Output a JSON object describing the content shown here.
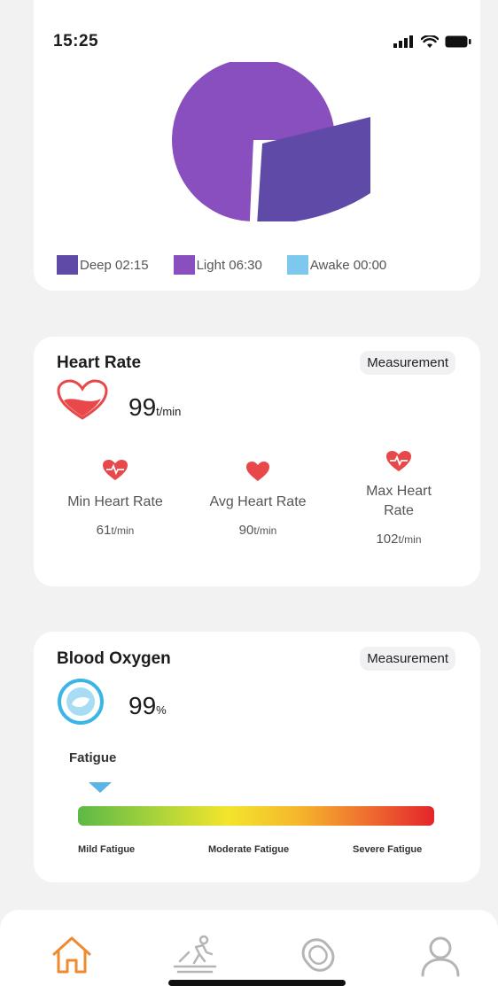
{
  "status_bar": {
    "time": "15:25"
  },
  "sleep": {
    "chart_data": {
      "type": "pie",
      "series": [
        {
          "name": "Deep",
          "value": 2.25
        },
        {
          "name": "Light",
          "value": 6.5
        },
        {
          "name": "Awake",
          "value": 0
        }
      ]
    },
    "legend": [
      {
        "label": "Deep 02:15",
        "color": "#5f4aa8"
      },
      {
        "label": "Light 06:30",
        "color": "#8a4fbf"
      },
      {
        "label": "Awake 00:00",
        "color": "#7cc8ee"
      }
    ]
  },
  "heart_rate": {
    "title": "Heart Rate",
    "measure_label": "Measurement",
    "value": "99",
    "unit": "t/min",
    "stats": [
      {
        "label": "Min Heart Rate",
        "value": "61",
        "unit": "t/min"
      },
      {
        "label": "Avg Heart Rate",
        "value": "90",
        "unit": "t/min"
      },
      {
        "label": "Max Heart Rate",
        "value": "102",
        "unit": "t/min"
      }
    ],
    "accent": "#e8484a"
  },
  "blood_oxygen": {
    "title": "Blood Oxygen",
    "measure_label": "Measurement",
    "value": "99",
    "unit": "%",
    "accent": "#3bb4e6",
    "fatigue": {
      "title": "Fatigue",
      "level": 0.03,
      "labels": [
        "Mild Fatigue",
        "Moderate Fatigue",
        "Severe Fatigue"
      ]
    }
  },
  "tabs": [
    {
      "name": "home",
      "icon": "home-icon",
      "active": true
    },
    {
      "name": "sport",
      "icon": "treadmill-icon",
      "active": false
    },
    {
      "name": "device",
      "icon": "band-icon",
      "active": false
    },
    {
      "name": "profile",
      "icon": "person-icon",
      "active": false
    }
  ],
  "colors": {
    "active_tab": "#f08a2e",
    "inactive_tab": "#b5b5b8"
  }
}
